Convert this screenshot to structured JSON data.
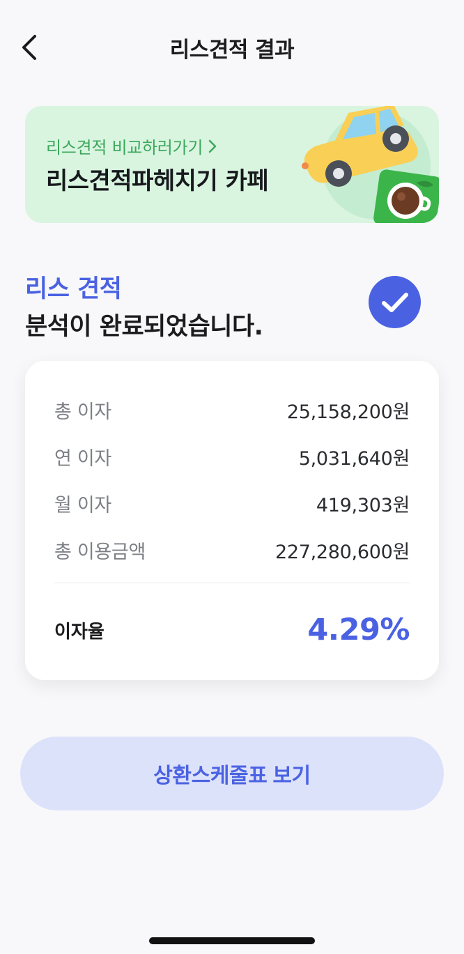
{
  "header": {
    "title": "리스견적 결과",
    "back_icon": "chevron-left-icon"
  },
  "banner": {
    "link_text": "리스견적 비교하러가기",
    "link_icon": "chevron-right-icon",
    "title": "리스견적파헤치기 카페",
    "background": "#d9f5e0",
    "link_color": "#3ca75b"
  },
  "status": {
    "highlight": "리스 견적",
    "message": "분석이 완료되었습니다.",
    "icon": "check-circle-icon",
    "accent": "#4a62e2"
  },
  "summary": {
    "rows": [
      {
        "label": "총 이자",
        "value": "25,158,200원"
      },
      {
        "label": "연 이자",
        "value": "5,031,640원"
      },
      {
        "label": "월 이자",
        "value": "419,303원"
      },
      {
        "label": "총 이용금액",
        "value": "227,280,600원"
      }
    ],
    "rate_label": "이자율",
    "rate_value": "4.29%"
  },
  "actions": {
    "schedule_label": "상환스케줄표 보기",
    "button_bg": "#dde2fb"
  }
}
